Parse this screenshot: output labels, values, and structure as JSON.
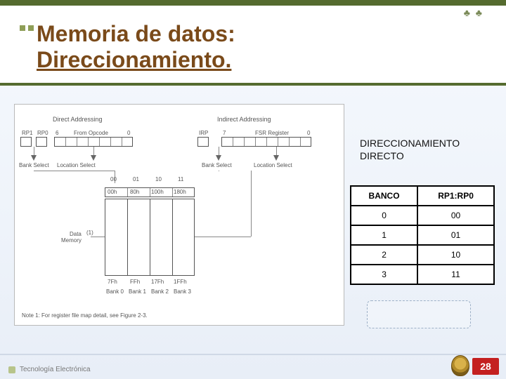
{
  "header": {
    "title_line1": "Memoria de datos:",
    "title_line2": "Direccionamiento."
  },
  "diagram": {
    "direct_label": "Direct Addressing",
    "indirect_label": "Indirect Addressing",
    "rp_labels": {
      "rp1": "RP1",
      "rp0": "RP0"
    },
    "from_opcode": "From Opcode",
    "from_opcode_msb": "6",
    "from_opcode_lsb": "0",
    "irp": "IRP",
    "fsr": "FSR Register",
    "fsr_msb": "7",
    "fsr_lsb": "0",
    "bank_select_left": "Bank Select",
    "location_select_left": "Location Select",
    "bank_select_right": "Bank Select",
    "location_select_right": "Location Select",
    "bank_bits": [
      "00",
      "01",
      "10",
      "11"
    ],
    "addr_top": [
      "00h",
      "80h",
      "100h",
      "180h"
    ],
    "addr_bottom": [
      "7Fh",
      "FFh",
      "17Fh",
      "1FFh"
    ],
    "bank_names": [
      "Bank 0",
      "Bank 1",
      "Bank 2",
      "Bank 3"
    ],
    "data_memory": "Data\nMemory",
    "note_sup": "(1)",
    "note": "Note 1: For register file map detail, see Figure 2-3."
  },
  "right_panel": {
    "title_line1": "DIRECCIONAMIENTO",
    "title_line2": "DIRECTO"
  },
  "table": {
    "headers": [
      "BANCO",
      "RP1:RP0"
    ],
    "rows": [
      [
        "0",
        "00"
      ],
      [
        "1",
        "01"
      ],
      [
        "2",
        "10"
      ],
      [
        "3",
        "11"
      ]
    ]
  },
  "footer": {
    "text": "Tecnología Electrónica",
    "page": "28"
  }
}
